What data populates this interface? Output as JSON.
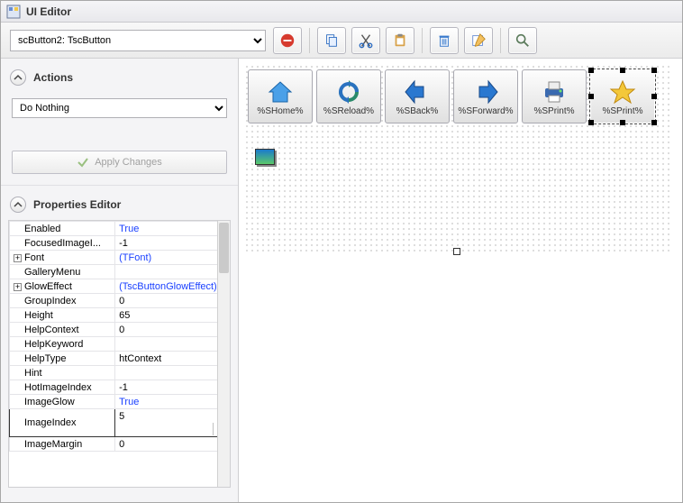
{
  "title": "UI Editor",
  "typeSelectValue": "scButton2: TscButton",
  "actions": {
    "header": "Actions",
    "selectValue": "Do Nothing",
    "applyLabel": "Apply Changes"
  },
  "propertiesHeader": "Properties Editor",
  "properties": [
    {
      "key": "Enabled",
      "value": "True",
      "blue": true
    },
    {
      "key": "FocusedImageI...",
      "value": "-1"
    },
    {
      "key": "Font",
      "value": "(TFont)",
      "blue": true,
      "expand": true
    },
    {
      "key": "GalleryMenu",
      "value": ""
    },
    {
      "key": "GlowEffect",
      "value": "(TscButtonGlowEffect)",
      "blue": true,
      "expand": true
    },
    {
      "key": "GroupIndex",
      "value": "0"
    },
    {
      "key": "Height",
      "value": "65"
    },
    {
      "key": "HelpContext",
      "value": "0"
    },
    {
      "key": "HelpKeyword",
      "value": ""
    },
    {
      "key": "HelpType",
      "value": "htContext"
    },
    {
      "key": "Hint",
      "value": ""
    },
    {
      "key": "HotImageIndex",
      "value": "-1"
    },
    {
      "key": "ImageGlow",
      "value": "True",
      "blue": true
    },
    {
      "key": "ImageIndex",
      "value": "5",
      "selected": true,
      "dropdown": true
    },
    {
      "key": "ImageMargin",
      "value": "0"
    }
  ],
  "designButtons": [
    {
      "label": "%SHome%",
      "icon": "home"
    },
    {
      "label": "%SReload%",
      "icon": "reload"
    },
    {
      "label": "%SBack%",
      "icon": "back"
    },
    {
      "label": "%SForward%",
      "icon": "forward"
    },
    {
      "label": "%SPrint%",
      "icon": "print"
    },
    {
      "label": "%SPrint%",
      "icon": "star",
      "selected": true
    }
  ],
  "toolbarIcons": [
    "stop",
    "copy",
    "cut",
    "paste",
    "delete",
    "edit",
    "zoom"
  ]
}
